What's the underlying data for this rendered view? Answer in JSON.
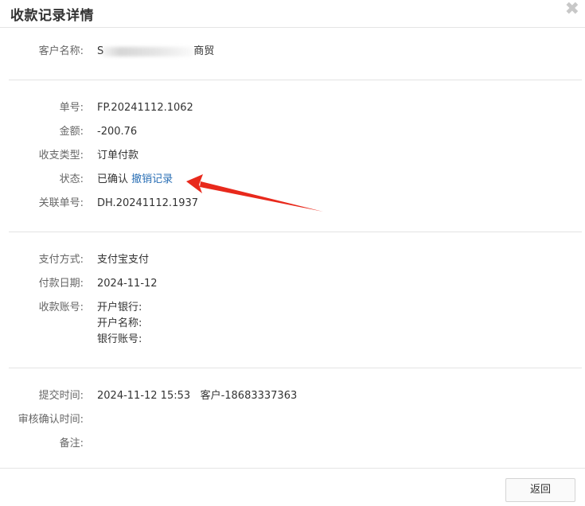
{
  "dialog": {
    "title": "收款记录详情",
    "close_icon": "close-icon",
    "back_label": "返回"
  },
  "customer": {
    "label": "客户名称:",
    "value_prefix": "S",
    "value_suffix": "商贸",
    "value_obscured": true
  },
  "details": {
    "order_no_label": "单号:",
    "order_no": "FP.20241112.1062",
    "amount_label": "金额:",
    "amount": "-200.76",
    "type_label": "收支类型:",
    "type": "订单付款",
    "status_label": "状态:",
    "status": "已确认",
    "revoke_link": "撤销记录",
    "related_label": "关联单号:",
    "related_no": "DH.20241112.1937"
  },
  "payment": {
    "method_label": "支付方式:",
    "method": "支付宝支付",
    "date_label": "付款日期:",
    "date": "2024-11-12",
    "account_label": "收款账号:",
    "bank_label": "开户银行:",
    "name_label": "开户名称:",
    "account_no_label": "银行账号:"
  },
  "submit": {
    "time_label": "提交时间:",
    "time": "2024-11-12 15:53",
    "submitter": "客户-18683337363",
    "audit_label": "审核确认时间:",
    "note_label": "备注:"
  },
  "annotation": {
    "arrow_color": "#e8291c"
  }
}
